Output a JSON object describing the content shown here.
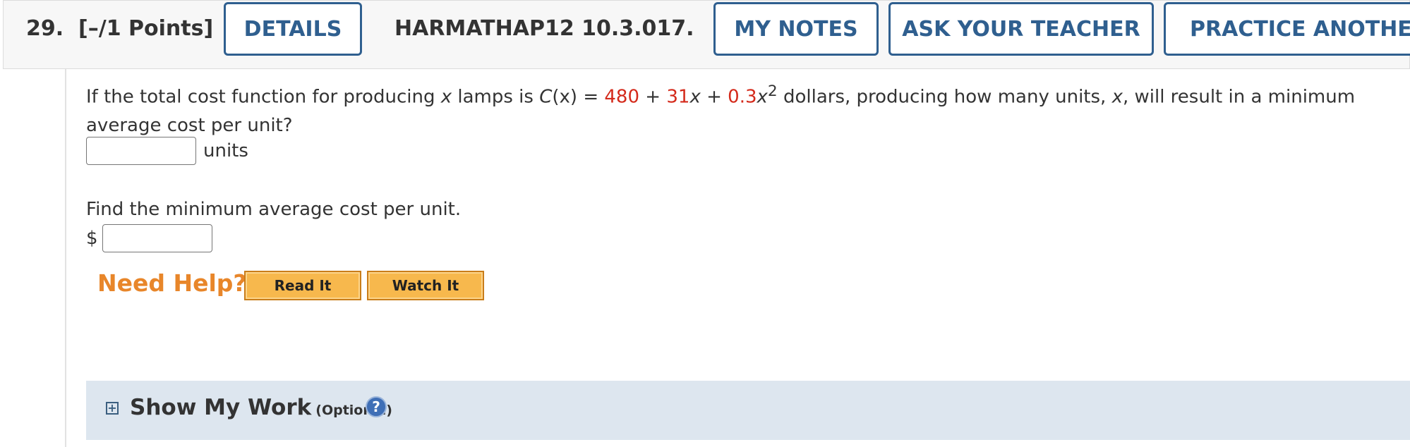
{
  "header": {
    "question_number": "29.",
    "points": "[–/1 Points]",
    "details_label": "DETAILS",
    "assignment_code": "HARMATHAP12 10.3.017.",
    "my_notes_label": "MY NOTES",
    "ask_teacher_label": "ASK YOUR TEACHER",
    "practice_label": "PRACTICE ANOTHER"
  },
  "question": {
    "text_before": "If the total cost function for producing ",
    "var_x": "x",
    "text_lamps": " lamps is ",
    "func": "C",
    "func_arg": "(x)",
    "equals": " = ",
    "const": "480",
    "plus1": " + ",
    "coef1": "31",
    "x1": "x",
    "plus2": " + ",
    "coef2": "0.3",
    "x2": "x",
    "exp": "2",
    "text_after": " dollars, producing how many units, ",
    "var_x2": "x",
    "text_end": ", will result in a minimum average cost per unit?"
  },
  "answer1": {
    "unit_label": "units",
    "value": ""
  },
  "prompt2": "Find the minimum average cost per unit.",
  "answer2": {
    "currency": "$",
    "value": ""
  },
  "help": {
    "label": "Need Help?",
    "read_label": "Read It",
    "watch_label": "Watch It"
  },
  "work": {
    "expand_symbol": "+",
    "title": "Show My Work",
    "optional": "(Optional)",
    "help_symbol": "?"
  },
  "colors": {
    "accent": "#2f5f8f",
    "red": "#d42a1b",
    "help_orange": "#e8862a",
    "button_fill": "#f7b84d"
  }
}
